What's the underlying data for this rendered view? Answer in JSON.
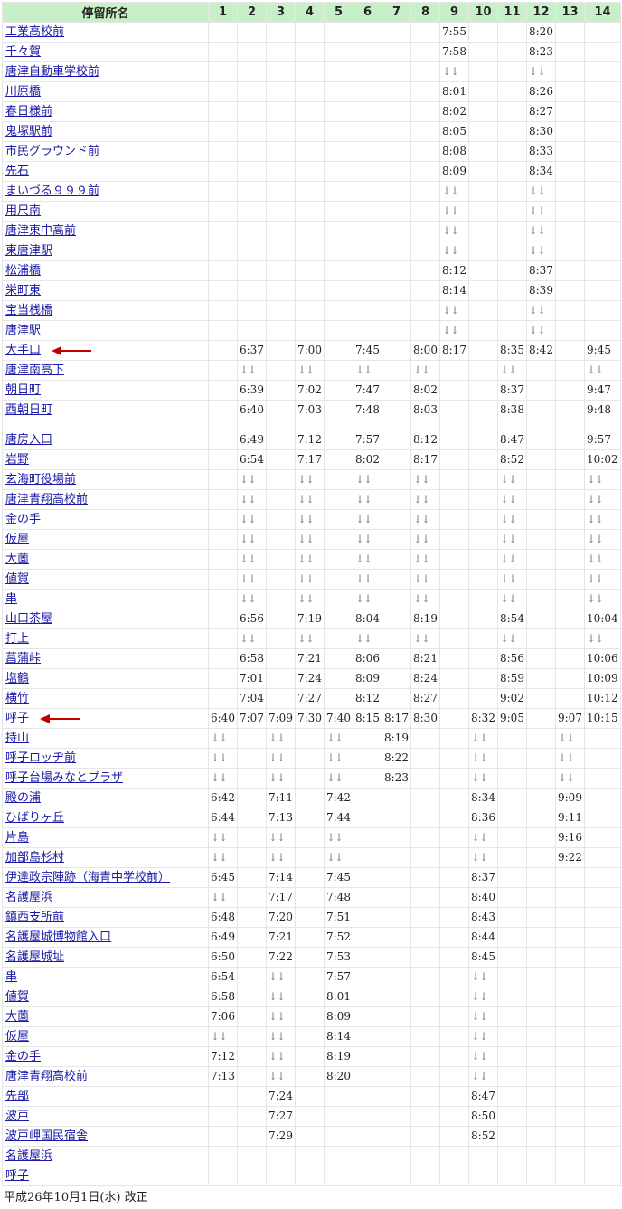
{
  "header": {
    "stop_name_label": "停留所名",
    "columns": [
      "1",
      "2",
      "3",
      "4",
      "5",
      "6",
      "7",
      "8",
      "9",
      "10",
      "11",
      "12",
      "13",
      "14"
    ]
  },
  "pass_symbol": "↓↓",
  "arrow_color": "#c00000",
  "header_bg": "#c8f0c8",
  "link_color": "#1a1aa6",
  "stops": [
    {
      "name": "工業高校前",
      "times": [
        "",
        "",
        "",
        "",
        "",
        "",
        "",
        "",
        "7:55",
        "",
        "",
        "8:20",
        "",
        ""
      ]
    },
    {
      "name": "千々賀",
      "times": [
        "",
        "",
        "",
        "",
        "",
        "",
        "",
        "",
        "7:58",
        "",
        "",
        "8:23",
        "",
        ""
      ]
    },
    {
      "name": "唐津自動車学校前",
      "times": [
        "",
        "",
        "",
        "",
        "",
        "",
        "",
        "",
        "↓↓",
        "",
        "",
        "↓↓",
        "",
        ""
      ]
    },
    {
      "name": "川原橋",
      "times": [
        "",
        "",
        "",
        "",
        "",
        "",
        "",
        "",
        "8:01",
        "",
        "",
        "8:26",
        "",
        ""
      ]
    },
    {
      "name": "春日様前",
      "times": [
        "",
        "",
        "",
        "",
        "",
        "",
        "",
        "",
        "8:02",
        "",
        "",
        "8:27",
        "",
        ""
      ]
    },
    {
      "name": "鬼塚駅前",
      "times": [
        "",
        "",
        "",
        "",
        "",
        "",
        "",
        "",
        "8:05",
        "",
        "",
        "8:30",
        "",
        ""
      ]
    },
    {
      "name": "市民グラウンド前",
      "times": [
        "",
        "",
        "",
        "",
        "",
        "",
        "",
        "",
        "8:08",
        "",
        "",
        "8:33",
        "",
        ""
      ]
    },
    {
      "name": "先石",
      "times": [
        "",
        "",
        "",
        "",
        "",
        "",
        "",
        "",
        "8:09",
        "",
        "",
        "8:34",
        "",
        ""
      ]
    },
    {
      "name": "まいづる９９９前",
      "times": [
        "",
        "",
        "",
        "",
        "",
        "",
        "",
        "",
        "↓↓",
        "",
        "",
        "↓↓",
        "",
        ""
      ]
    },
    {
      "name": "用尺南",
      "times": [
        "",
        "",
        "",
        "",
        "",
        "",
        "",
        "",
        "↓↓",
        "",
        "",
        "↓↓",
        "",
        ""
      ]
    },
    {
      "name": "唐津東中高前",
      "times": [
        "",
        "",
        "",
        "",
        "",
        "",
        "",
        "",
        "↓↓",
        "",
        "",
        "↓↓",
        "",
        ""
      ]
    },
    {
      "name": "東唐津駅",
      "times": [
        "",
        "",
        "",
        "",
        "",
        "",
        "",
        "",
        "↓↓",
        "",
        "",
        "↓↓",
        "",
        ""
      ]
    },
    {
      "name": "松浦橋",
      "times": [
        "",
        "",
        "",
        "",
        "",
        "",
        "",
        "",
        "8:12",
        "",
        "",
        "8:37",
        "",
        ""
      ]
    },
    {
      "name": "栄町東",
      "times": [
        "",
        "",
        "",
        "",
        "",
        "",
        "",
        "",
        "8:14",
        "",
        "",
        "8:39",
        "",
        ""
      ]
    },
    {
      "name": "宝当桟橋",
      "times": [
        "",
        "",
        "",
        "",
        "",
        "",
        "",
        "",
        "↓↓",
        "",
        "",
        "↓↓",
        "",
        ""
      ]
    },
    {
      "name": "唐津駅",
      "times": [
        "",
        "",
        "",
        "",
        "",
        "",
        "",
        "",
        "↓↓",
        "",
        "",
        "↓↓",
        "",
        ""
      ]
    },
    {
      "name": "大手口",
      "arrow": true,
      "times": [
        "",
        "6:37",
        "",
        "7:00",
        "",
        "7:45",
        "",
        "8:00",
        "8:17",
        "",
        "8:35",
        "8:42",
        "",
        "9:45"
      ]
    },
    {
      "name": "唐津南高下",
      "times": [
        "",
        "↓↓",
        "",
        "↓↓",
        "",
        "↓↓",
        "",
        "↓↓",
        "",
        "",
        "↓↓",
        "",
        "",
        "↓↓"
      ]
    },
    {
      "name": "朝日町",
      "times": [
        "",
        "6:39",
        "",
        "7:02",
        "",
        "7:47",
        "",
        "8:02",
        "",
        "",
        "8:37",
        "",
        "",
        "9:47"
      ]
    },
    {
      "name": "西朝日町",
      "times": [
        "",
        "6:40",
        "",
        "7:03",
        "",
        "7:48",
        "",
        "8:03",
        "",
        "",
        "8:38",
        "",
        "",
        "9:48"
      ]
    },
    {
      "name": "",
      "cut": true,
      "times": [
        "",
        "",
        "",
        "",
        "",
        "",
        "",
        "",
        "",
        "",
        "",
        "",
        "",
        ""
      ]
    },
    {
      "name": "唐房入口",
      "times": [
        "",
        "6:49",
        "",
        "7:12",
        "",
        "7:57",
        "",
        "8:12",
        "",
        "",
        "8:47",
        "",
        "",
        "9:57"
      ]
    },
    {
      "name": "岩野",
      "times": [
        "",
        "6:54",
        "",
        "7:17",
        "",
        "8:02",
        "",
        "8:17",
        "",
        "",
        "8:52",
        "",
        "",
        "10:02"
      ]
    },
    {
      "name": "玄海町役場前",
      "times": [
        "",
        "↓↓",
        "",
        "↓↓",
        "",
        "↓↓",
        "",
        "↓↓",
        "",
        "",
        "↓↓",
        "",
        "",
        "↓↓"
      ]
    },
    {
      "name": "唐津青翔高校前",
      "times": [
        "",
        "↓↓",
        "",
        "↓↓",
        "",
        "↓↓",
        "",
        "↓↓",
        "",
        "",
        "↓↓",
        "",
        "",
        "↓↓"
      ]
    },
    {
      "name": "金の手",
      "times": [
        "",
        "↓↓",
        "",
        "↓↓",
        "",
        "↓↓",
        "",
        "↓↓",
        "",
        "",
        "↓↓",
        "",
        "",
        "↓↓"
      ]
    },
    {
      "name": "仮屋",
      "times": [
        "",
        "↓↓",
        "",
        "↓↓",
        "",
        "↓↓",
        "",
        "↓↓",
        "",
        "",
        "↓↓",
        "",
        "",
        "↓↓"
      ]
    },
    {
      "name": "大薗",
      "times": [
        "",
        "↓↓",
        "",
        "↓↓",
        "",
        "↓↓",
        "",
        "↓↓",
        "",
        "",
        "↓↓",
        "",
        "",
        "↓↓"
      ]
    },
    {
      "name": "値賀",
      "times": [
        "",
        "↓↓",
        "",
        "↓↓",
        "",
        "↓↓",
        "",
        "↓↓",
        "",
        "",
        "↓↓",
        "",
        "",
        "↓↓"
      ]
    },
    {
      "name": "串",
      "times": [
        "",
        "↓↓",
        "",
        "↓↓",
        "",
        "↓↓",
        "",
        "↓↓",
        "",
        "",
        "↓↓",
        "",
        "",
        "↓↓"
      ]
    },
    {
      "name": "山口茶屋",
      "times": [
        "",
        "6:56",
        "",
        "7:19",
        "",
        "8:04",
        "",
        "8:19",
        "",
        "",
        "8:54",
        "",
        "",
        "10:04"
      ]
    },
    {
      "name": "打上",
      "times": [
        "",
        "↓↓",
        "",
        "↓↓",
        "",
        "↓↓",
        "",
        "↓↓",
        "",
        "",
        "↓↓",
        "",
        "",
        "↓↓"
      ]
    },
    {
      "name": "菖蒲峠",
      "times": [
        "",
        "6:58",
        "",
        "7:21",
        "",
        "8:06",
        "",
        "8:21",
        "",
        "",
        "8:56",
        "",
        "",
        "10:06"
      ]
    },
    {
      "name": "塩鶴",
      "times": [
        "",
        "7:01",
        "",
        "7:24",
        "",
        "8:09",
        "",
        "8:24",
        "",
        "",
        "8:59",
        "",
        "",
        "10:09"
      ]
    },
    {
      "name": "横竹",
      "times": [
        "",
        "7:04",
        "",
        "7:27",
        "",
        "8:12",
        "",
        "8:27",
        "",
        "",
        "9:02",
        "",
        "",
        "10:12"
      ]
    },
    {
      "name": "呼子",
      "arrow": true,
      "times": [
        "6:40",
        "7:07",
        "7:09",
        "7:30",
        "7:40",
        "8:15",
        "8:17",
        "8:30",
        "",
        "8:32",
        "9:05",
        "",
        "9:07",
        "10:15"
      ]
    },
    {
      "name": "持山",
      "times": [
        "↓↓",
        "",
        "↓↓",
        "",
        "↓↓",
        "",
        "8:19",
        "",
        "",
        "↓↓",
        "",
        "",
        "↓↓",
        ""
      ]
    },
    {
      "name": "呼子ロッヂ前",
      "times": [
        "↓↓",
        "",
        "↓↓",
        "",
        "↓↓",
        "",
        "8:22",
        "",
        "",
        "↓↓",
        "",
        "",
        "↓↓",
        ""
      ]
    },
    {
      "name": "呼子台場みなとプラザ",
      "times": [
        "↓↓",
        "",
        "↓↓",
        "",
        "↓↓",
        "",
        "8:23",
        "",
        "",
        "↓↓",
        "",
        "",
        "↓↓",
        ""
      ]
    },
    {
      "name": "殿の浦",
      "times": [
        "6:42",
        "",
        "7:11",
        "",
        "7:42",
        "",
        "",
        "",
        "",
        "8:34",
        "",
        "",
        "9:09",
        ""
      ]
    },
    {
      "name": "ひばりヶ丘",
      "times": [
        "6:44",
        "",
        "7:13",
        "",
        "7:44",
        "",
        "",
        "",
        "",
        "8:36",
        "",
        "",
        "9:11",
        ""
      ]
    },
    {
      "name": "片島",
      "times": [
        "↓↓",
        "",
        "↓↓",
        "",
        "↓↓",
        "",
        "",
        "",
        "",
        "↓↓",
        "",
        "",
        "9:16",
        ""
      ]
    },
    {
      "name": "加部島杉村",
      "times": [
        "↓↓",
        "",
        "↓↓",
        "",
        "↓↓",
        "",
        "",
        "",
        "",
        "↓↓",
        "",
        "",
        "9:22",
        ""
      ]
    },
    {
      "name": "伊達政宗陣跡（海青中学校前）",
      "times": [
        "6:45",
        "",
        "7:14",
        "",
        "7:45",
        "",
        "",
        "",
        "",
        "8:37",
        "",
        "",
        "",
        ""
      ]
    },
    {
      "name": "名護屋浜",
      "times": [
        "↓↓",
        "",
        "7:17",
        "",
        "7:48",
        "",
        "",
        "",
        "",
        "8:40",
        "",
        "",
        "",
        ""
      ]
    },
    {
      "name": "鎮西支所前",
      "times": [
        "6:48",
        "",
        "7:20",
        "",
        "7:51",
        "",
        "",
        "",
        "",
        "8:43",
        "",
        "",
        "",
        ""
      ]
    },
    {
      "name": "名護屋城博物館入口",
      "times": [
        "6:49",
        "",
        "7:21",
        "",
        "7:52",
        "",
        "",
        "",
        "",
        "8:44",
        "",
        "",
        "",
        ""
      ]
    },
    {
      "name": "名護屋城址",
      "times": [
        "6:50",
        "",
        "7:22",
        "",
        "7:53",
        "",
        "",
        "",
        "",
        "8:45",
        "",
        "",
        "",
        ""
      ]
    },
    {
      "name": "串",
      "times": [
        "6:54",
        "",
        "↓↓",
        "",
        "7:57",
        "",
        "",
        "",
        "",
        "↓↓",
        "",
        "",
        "",
        ""
      ]
    },
    {
      "name": "値賀",
      "times": [
        "6:58",
        "",
        "↓↓",
        "",
        "8:01",
        "",
        "",
        "",
        "",
        "↓↓",
        "",
        "",
        "",
        ""
      ]
    },
    {
      "name": "大薗",
      "times": [
        "7:06",
        "",
        "↓↓",
        "",
        "8:09",
        "",
        "",
        "",
        "",
        "↓↓",
        "",
        "",
        "",
        ""
      ]
    },
    {
      "name": "仮屋",
      "times": [
        "↓↓",
        "",
        "↓↓",
        "",
        "8:14",
        "",
        "",
        "",
        "",
        "↓↓",
        "",
        "",
        "",
        ""
      ]
    },
    {
      "name": "金の手",
      "times": [
        "7:12",
        "",
        "↓↓",
        "",
        "8:19",
        "",
        "",
        "",
        "",
        "↓↓",
        "",
        "",
        "",
        ""
      ]
    },
    {
      "name": "唐津青翔高校前",
      "times": [
        "7:13",
        "",
        "↓↓",
        "",
        "8:20",
        "",
        "",
        "",
        "",
        "↓↓",
        "",
        "",
        "",
        ""
      ]
    },
    {
      "name": "先部",
      "times": [
        "",
        "",
        "7:24",
        "",
        "",
        "",
        "",
        "",
        "",
        "8:47",
        "",
        "",
        "",
        ""
      ]
    },
    {
      "name": "波戸",
      "times": [
        "",
        "",
        "7:27",
        "",
        "",
        "",
        "",
        "",
        "",
        "8:50",
        "",
        "",
        "",
        ""
      ]
    },
    {
      "name": "波戸岬国民宿舎",
      "times": [
        "",
        "",
        "7:29",
        "",
        "",
        "",
        "",
        "",
        "",
        "8:52",
        "",
        "",
        "",
        ""
      ]
    },
    {
      "name": "名護屋浜",
      "times": [
        "",
        "",
        "",
        "",
        "",
        "",
        "",
        "",
        "",
        "",
        "",
        "",
        "",
        ""
      ]
    },
    {
      "name": "呼子",
      "times": [
        "",
        "",
        "",
        "",
        "",
        "",
        "",
        "",
        "",
        "",
        "",
        "",
        "",
        ""
      ]
    }
  ],
  "footer": "平成26年10月1日(水) 改正"
}
